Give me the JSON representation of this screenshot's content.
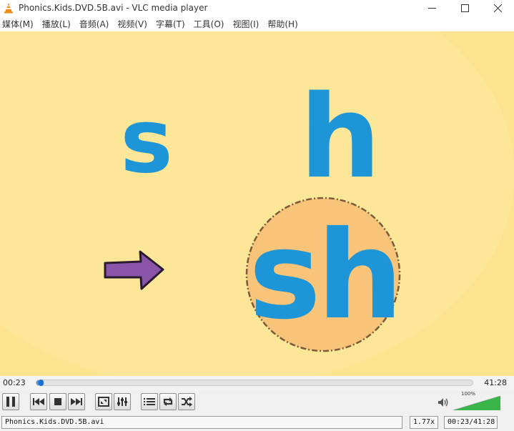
{
  "window": {
    "title": "Phonics.Kids.DVD.5B.avi - VLC media player",
    "app_icon": "vlc-cone-icon",
    "controls": [
      "minimize-icon",
      "maximize-icon",
      "close-icon"
    ]
  },
  "menu": {
    "items": [
      "媒体(M)",
      "播放(L)",
      "音频(A)",
      "视频(V)",
      "字幕(T)",
      "工具(O)",
      "视图(I)",
      "帮助(H)"
    ]
  },
  "video": {
    "letter_left": "s",
    "letter_right": "h",
    "combined": "sh",
    "colors": {
      "background": "#fbe38f",
      "letters": "#1d95d6",
      "circle": "#f7c47a",
      "arrow": "#8a55a8"
    }
  },
  "playback": {
    "elapsed": "00:23",
    "total": "41:28",
    "progress_fraction": 0.0092
  },
  "controls": {
    "buttons": [
      "pause-icon",
      "previous-icon",
      "stop-icon",
      "next-icon",
      "fullscreen-icon",
      "extended-settings-icon",
      "playlist-icon",
      "loop-icon",
      "shuffle-icon"
    ],
    "volume_icon": "speaker-icon",
    "volume_label": "100%",
    "volume_fraction": 1.0
  },
  "status": {
    "filename": "Phonics.Kids.DVD.5B.avi",
    "speed": "1.77x",
    "time": "00:23/41:28"
  }
}
